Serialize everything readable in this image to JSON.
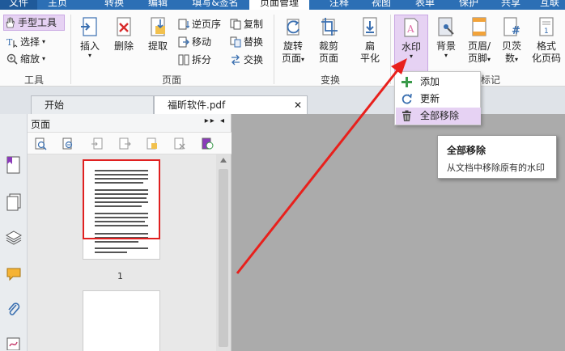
{
  "menu": {
    "tabs": [
      {
        "label": "文件"
      },
      {
        "label": "主页"
      },
      {
        "label": "转换"
      },
      {
        "label": "编辑"
      },
      {
        "label": "填写&签名"
      },
      {
        "label": "页面管理"
      },
      {
        "label": "注释"
      },
      {
        "label": "视图"
      },
      {
        "label": "表单"
      },
      {
        "label": "保护"
      },
      {
        "label": "共享"
      },
      {
        "label": "互联"
      }
    ]
  },
  "ribbon": {
    "tools": {
      "hand": "手型工具",
      "select": "选择",
      "zoom": "缩放",
      "group": "工具"
    },
    "page": {
      "insert": "插入",
      "delete": "删除",
      "extract": "提取",
      "reverse": "逆页序",
      "move": "移动",
      "split": "拆分",
      "copy": "复制",
      "replace": "替换",
      "swap": "交换",
      "group": "页面"
    },
    "transform": {
      "rotate_line1": "旋转",
      "rotate_line2": "页面",
      "crop_line1": "裁剪",
      "crop_line2": "页面",
      "flatten_line1": "扁",
      "flatten_line2": "平化",
      "group": "变换"
    },
    "mark": {
      "watermark": "水印",
      "background": "背景",
      "header_line1": "页眉/",
      "header_line2": "页脚",
      "bates_line1": "贝茨",
      "bates_line2": "数",
      "format_line1": "格式",
      "format_line2": "化页码",
      "group": "标记"
    }
  },
  "doc_tabs": {
    "start": "开始",
    "file": "福昕软件.pdf",
    "close": "✕"
  },
  "panel": {
    "title": "页面",
    "controls": "▸▸ ◂",
    "page1_number": "1"
  },
  "dropdown": {
    "items": [
      {
        "label": "添加"
      },
      {
        "label": "更新"
      },
      {
        "label": "全部移除"
      }
    ]
  },
  "tooltip": {
    "title": "全部移除",
    "desc": "从文档中移除原有的水印"
  },
  "colors": {
    "menubar": "#2c6fb5",
    "selected": "#e6d2f3",
    "arrow": "#e8201c",
    "work_area": "#ababab"
  }
}
